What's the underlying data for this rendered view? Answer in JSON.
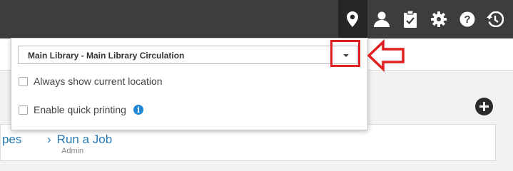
{
  "topbar": {
    "icons": [
      "location-pin-icon",
      "user-icon",
      "task-list-icon",
      "gear-icon",
      "help-icon",
      "history-icon"
    ],
    "active_icon": "location-pin-icon",
    "background": "#3d3d3d"
  },
  "location_dropdown": {
    "selected_location": "Main Library - Main Library Circulation",
    "options": [
      {
        "label": "Always show current location",
        "checked": false
      },
      {
        "label": "Enable quick printing",
        "checked": false
      }
    ],
    "info_icon_glyph": "i"
  },
  "annotation": {
    "highlight_color": "#e02020"
  },
  "background_page": {
    "partial_link": "pes",
    "run_job_label": "Run a Job",
    "run_job_sub": "Admin",
    "add_widget_icon": "plus-circle-icon"
  }
}
